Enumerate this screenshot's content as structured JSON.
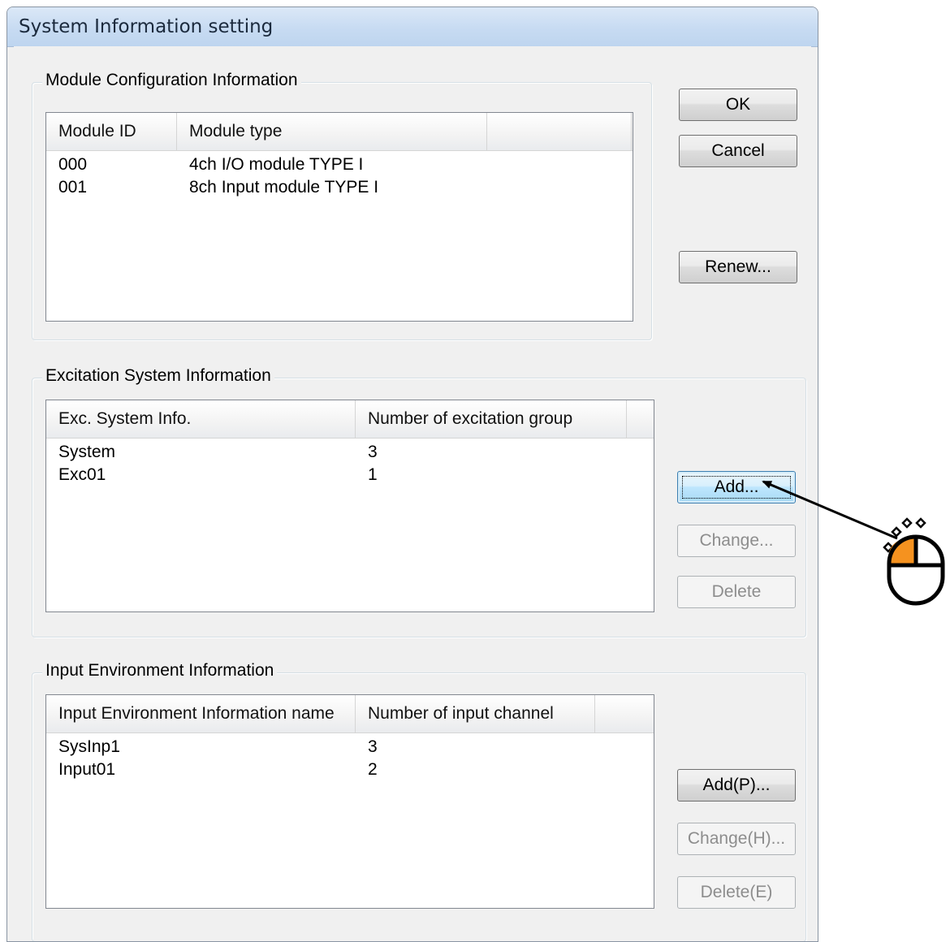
{
  "window": {
    "title": "System Information setting"
  },
  "module_group": {
    "legend": "Module Configuration Information",
    "columns": [
      "Module ID",
      "Module type"
    ],
    "rows": [
      [
        "000",
        "4ch I/O module TYPE I"
      ],
      [
        "001",
        "8ch Input module TYPE I"
      ]
    ]
  },
  "excitation_group": {
    "legend": "Excitation System Information",
    "columns": [
      "Exc. System Info.",
      "Number of excitation group"
    ],
    "rows": [
      [
        "System",
        "3"
      ],
      [
        "Exc01",
        "1"
      ]
    ],
    "buttons": {
      "add": "Add...",
      "change": "Change...",
      "delete": "Delete"
    }
  },
  "input_group": {
    "legend": "Input Environment Information",
    "columns": [
      "Input Environment Information name",
      "Number of input channel"
    ],
    "rows": [
      [
        "SysInp1",
        "3"
      ],
      [
        "Input01",
        "2"
      ]
    ],
    "buttons": {
      "add": "Add(P)...",
      "change": "Change(H)...",
      "delete": "Delete(E)"
    }
  },
  "buttons": {
    "ok": "OK",
    "cancel": "Cancel",
    "renew": "Renew..."
  },
  "annotation": {
    "cursor_icon": "mouse-left-click-icon",
    "accent_color": "#f5921f"
  }
}
